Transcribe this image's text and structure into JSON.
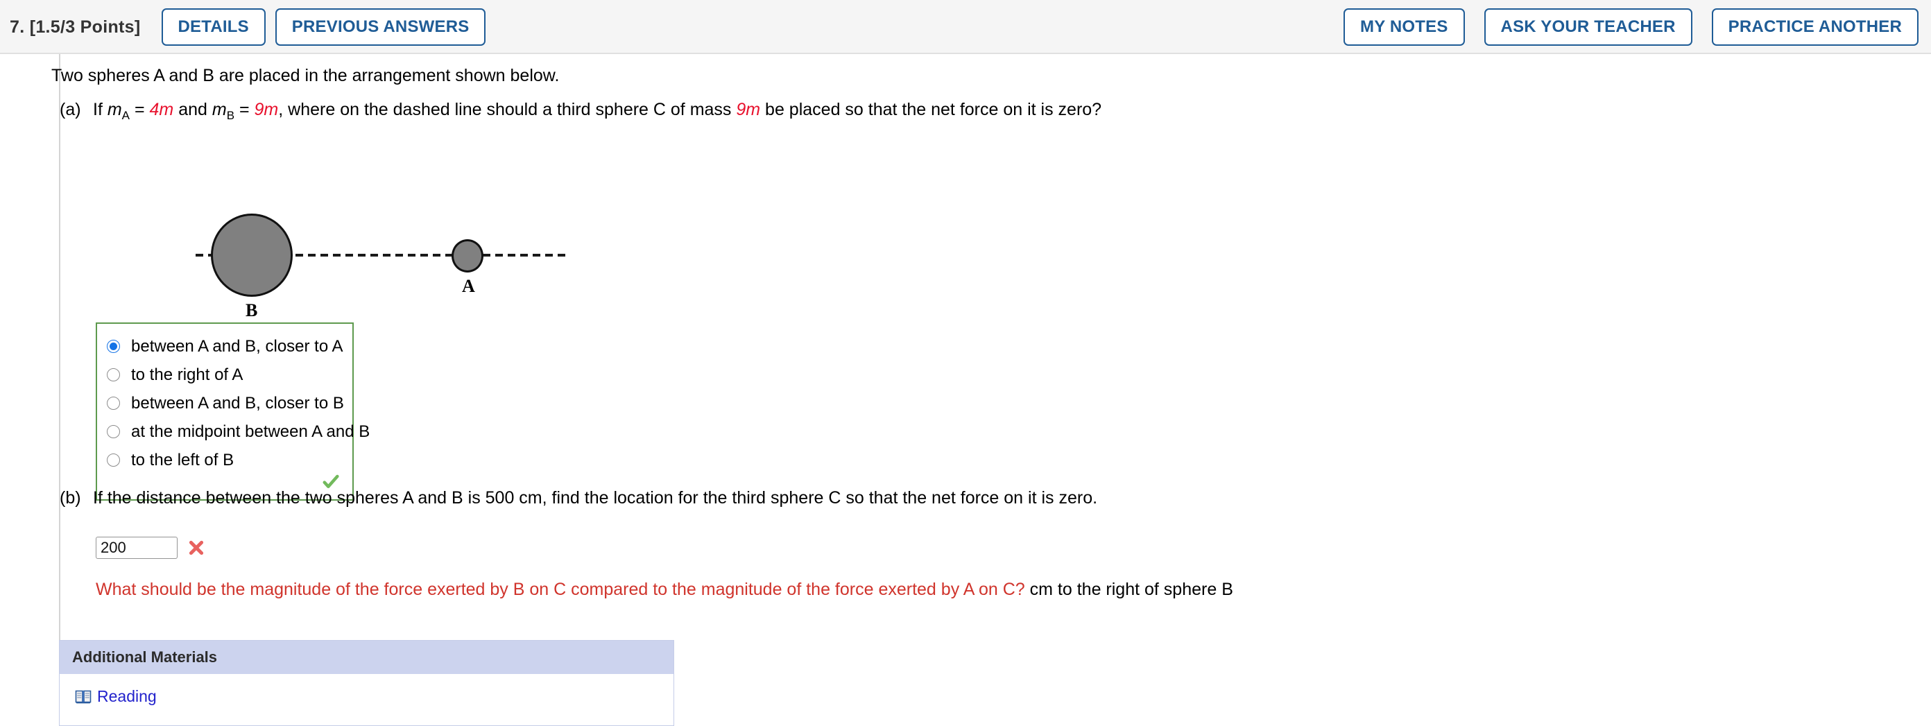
{
  "header": {
    "question_number": "7.",
    "points": "[1.5/3 Points]",
    "points_label": "7.  [1.5/3 Points]",
    "left_buttons": [
      {
        "label": "DETAILS",
        "name": "details-button"
      },
      {
        "label": "PREVIOUS ANSWERS",
        "name": "previous-answers-button"
      }
    ],
    "right_buttons": [
      {
        "label": "MY NOTES",
        "name": "my-notes-button"
      },
      {
        "label": "ASK YOUR TEACHER",
        "name": "ask-your-teacher-button"
      },
      {
        "label": "PRACTICE ANOTHER",
        "name": "practice-another-button"
      }
    ]
  },
  "question": {
    "intro": "Two spheres A and B are placed in the arrangement shown below.",
    "part_a": {
      "tag": "(a)",
      "text_1": "If ",
      "m_a": "m",
      "sub_a": "A",
      "eq1": " = ",
      "val_a": "4m",
      "text_2": " and ",
      "m_b": "m",
      "sub_b": "B",
      "eq2": " = ",
      "val_b": "9m",
      "text_3": ", where on the dashed line should a third sphere C of mass ",
      "val_c": "9m",
      "text_4": " be placed so that the net force on it is zero?"
    },
    "part_b": {
      "tag": "(b)",
      "text": "If the distance between the two spheres A and B is 500 cm, find the location for the third sphere C so that the net force on it is zero.",
      "answer_value": "200",
      "answer_placeholder": "",
      "grade_icon": "red-x-icon",
      "hint_red": "What should be the magnitude of the force exerted by B on C compared to the magnitude of the force exerted by A on C?",
      "unit_text": " cm to the right of sphere B"
    }
  },
  "figure": {
    "sphere_b_label": "B",
    "sphere_a_label": "A",
    "sphere_fill": "#808080",
    "line_style": "dashed"
  },
  "choices": {
    "options": [
      {
        "label": "between A and B, closer to A",
        "selected": true
      },
      {
        "label": "to the right of A",
        "selected": false
      },
      {
        "label": "between A and B, closer to B",
        "selected": false
      },
      {
        "label": "at the midpoint between A and B",
        "selected": false
      },
      {
        "label": "to the left of B",
        "selected": false
      }
    ],
    "grade_icon": "green-check-icon",
    "border_color": "#5e9a4e"
  },
  "additional_materials": {
    "title": "Additional Materials",
    "items": [
      {
        "label": "Reading",
        "icon": "book-icon"
      }
    ],
    "header_bg": "#ccd3ee"
  }
}
